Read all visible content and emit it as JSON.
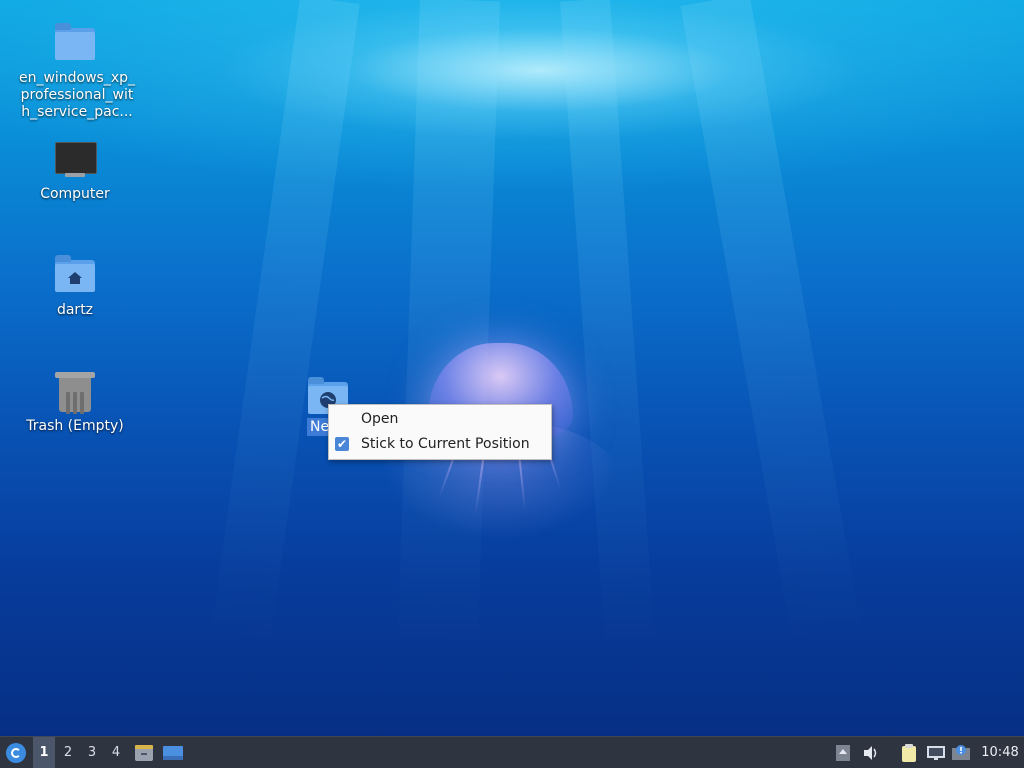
{
  "desktop": {
    "icons": [
      {
        "label": "en_windows_xp_ professional_wit h_service_pac...",
        "icon": "folder-icon"
      },
      {
        "label": "Computer",
        "icon": "computer-icon"
      },
      {
        "label": "dartz",
        "icon": "home-folder-icon"
      },
      {
        "label": "Trash (Empty)",
        "icon": "trash-icon"
      },
      {
        "label": "Netw",
        "icon": "network-folder-icon"
      }
    ]
  },
  "context_menu": {
    "items": [
      {
        "label": "Open",
        "checked": false
      },
      {
        "label": "Stick to Current Position",
        "checked": true
      }
    ]
  },
  "taskbar": {
    "workspaces": [
      "1",
      "2",
      "3",
      "4"
    ],
    "active_workspace": "1",
    "clock": "10:48"
  }
}
